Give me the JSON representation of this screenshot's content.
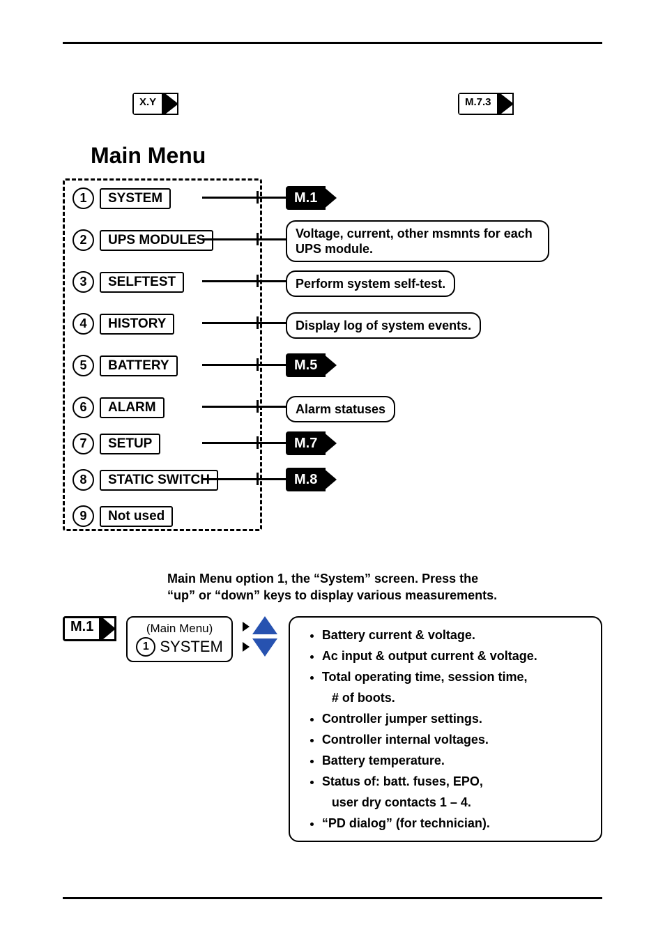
{
  "legend": {
    "xy": "X.Y",
    "sample": "M.7.3"
  },
  "main_title": "Main Menu",
  "items": [
    {
      "n": "1",
      "label": "SYSTEM",
      "target": "M.1",
      "desc": null
    },
    {
      "n": "2",
      "label": "UPS MODULES",
      "target": null,
      "desc": "Voltage, current, other msmnts for each UPS module."
    },
    {
      "n": "3",
      "label": "SELFTEST",
      "target": null,
      "desc": "Perform system self-test."
    },
    {
      "n": "4",
      "label": "HISTORY",
      "target": null,
      "desc": "Display log of system events."
    },
    {
      "n": "5",
      "label": "BATTERY",
      "target": "M.5",
      "desc": null
    },
    {
      "n": "6",
      "label": "ALARM",
      "target": null,
      "desc": "Alarm statuses"
    },
    {
      "n": "7",
      "label": "SETUP",
      "target": "M.7",
      "desc": null
    },
    {
      "n": "8",
      "label": "STATIC SWITCH",
      "target": "M.8",
      "desc": null
    },
    {
      "n": "9",
      "label": "Not used",
      "target": null,
      "desc": null
    }
  ],
  "system_panel": {
    "title_line1": "Main Menu option 1, the “System” screen. Press the",
    "title_line2": "“up” or “down” keys to display various measurements.",
    "ref_tag": "M.1",
    "ref_caption": "(Main Menu)",
    "ref_num": "1",
    "ref_label": "SYSTEM",
    "bullets": [
      "Battery current & voltage.",
      "Ac input & output current & voltage.",
      "Total operating time, session time,",
      "# of boots.",
      "Controller jumper settings.",
      "Controller internal voltages.",
      "Battery temperature.",
      "Status of: batt. fuses, EPO,",
      "user dry contacts 1 – 4.",
      "“PD dialog” (for technician)."
    ],
    "indent_indices": [
      3,
      8
    ]
  }
}
